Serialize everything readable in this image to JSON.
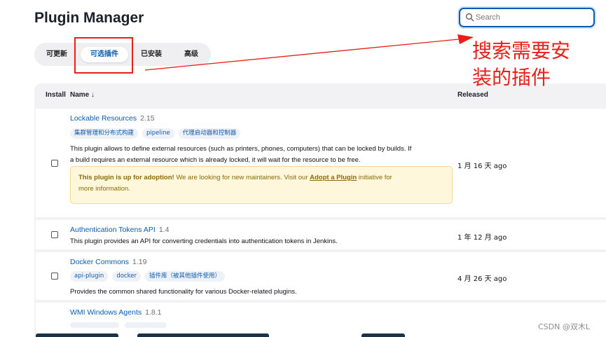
{
  "header": {
    "title": "Plugin Manager",
    "search_placeholder": "Search"
  },
  "tabs": [
    {
      "label": "可更新",
      "active": false
    },
    {
      "label": "可选插件",
      "active": true
    },
    {
      "label": "已安装",
      "active": false
    },
    {
      "label": "高级",
      "active": false
    }
  ],
  "annotation": {
    "line1": "搜索需要安",
    "line2": "装的插件",
    "color": "#e8201a"
  },
  "table": {
    "col_install": "Install",
    "col_name": "Name ↓",
    "col_released": "Released"
  },
  "plugins": [
    {
      "name": "Lockable Resources",
      "version": "2.15",
      "tags": [
        "集群管理和分布式构建",
        "pipeline",
        "代理启动器和控制器"
      ],
      "desc_line1": "This plugin allows to define external resources (such as printers, phones, computers) that can be locked by builds. If",
      "desc_line2": "a build requires an external resource which is already locked, it will wait for the resource to be free.",
      "adoption": {
        "bold": "This plugin is up for adoption!",
        "text_before": " We are looking for new maintainers. Visit our ",
        "link": "Adopt a Plugin",
        "text_after": " initiative for",
        "line2": "more information."
      },
      "released": "1 月 16 天 ago"
    },
    {
      "name": "Authentication Tokens API",
      "version": "1.4",
      "desc_line1": "This plugin provides an API for converting credentials into authentication tokens in Jenkins.",
      "released": "1 年 12 月 ago"
    },
    {
      "name": "Docker Commons",
      "version": "1.19",
      "tags": [
        "api-plugin",
        "docker",
        "插件库（被其他插件使用）"
      ],
      "desc_line1": "Provides the common shared functionality for various Docker-related plugins.",
      "released": "4 月 26 天 ago"
    },
    {
      "name": "WMI Windows Agents",
      "version": "1.8.1"
    }
  ],
  "watermark": "CSDN @双木L",
  "colors": {
    "accent": "#0b5cad",
    "annotation": "#e8201a",
    "adoption_bg": "#fef7dc"
  }
}
